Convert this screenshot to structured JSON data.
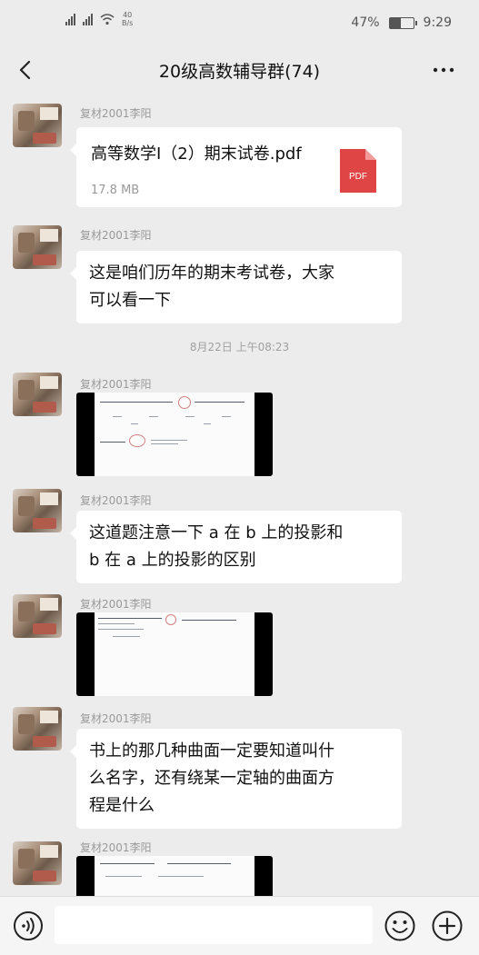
{
  "status_bar": {
    "carrier_1": "4G",
    "carrier_2": "4G",
    "net_speed_value": "40",
    "net_speed_unit": "B/s",
    "battery": "47%",
    "battery_level": 0.47,
    "time": "9:29"
  },
  "header": {
    "title": "20级高数辅导群(74)"
  },
  "messages": [
    {
      "sender": "复材2001李阳",
      "type": "file",
      "file_name": "高等数学Ⅰ（2）期末试卷.pdf",
      "file_size": "17.8 MB",
      "file_icon_label": "PDF"
    },
    {
      "sender": "复材2001李阳",
      "type": "text",
      "lines": [
        "这是咱们历年的期末考试卷，大家",
        "可以看一下"
      ]
    },
    {
      "type": "time",
      "text": "8月22日 上午08:23"
    },
    {
      "sender": "复材2001李阳",
      "type": "image"
    },
    {
      "sender": "复材2001李阳",
      "type": "text",
      "lines": [
        "这道题注意一下 a 在 b 上的投影和",
        "b 在 a 上的投影的区别"
      ]
    },
    {
      "sender": "复材2001李阳",
      "type": "image"
    },
    {
      "sender": "复材2001李阳",
      "type": "text",
      "lines": [
        "书上的那几种曲面一定要知道叫什",
        "么名字，还有绕某一定轴的曲面方",
        "程是什么"
      ]
    },
    {
      "sender": "复材2001李阳",
      "type": "image"
    }
  ],
  "input": {
    "placeholder": ""
  },
  "icons": {
    "back": "chevron-left-icon",
    "more": "more-dots-icon",
    "voice": "voice-icon",
    "emoji": "emoji-icon",
    "plus": "plus-icon",
    "pdf": "pdf-file-icon"
  },
  "colors": {
    "background": "#ececec",
    "bubble": "#ffffff",
    "pdf_red": "#e04545"
  }
}
